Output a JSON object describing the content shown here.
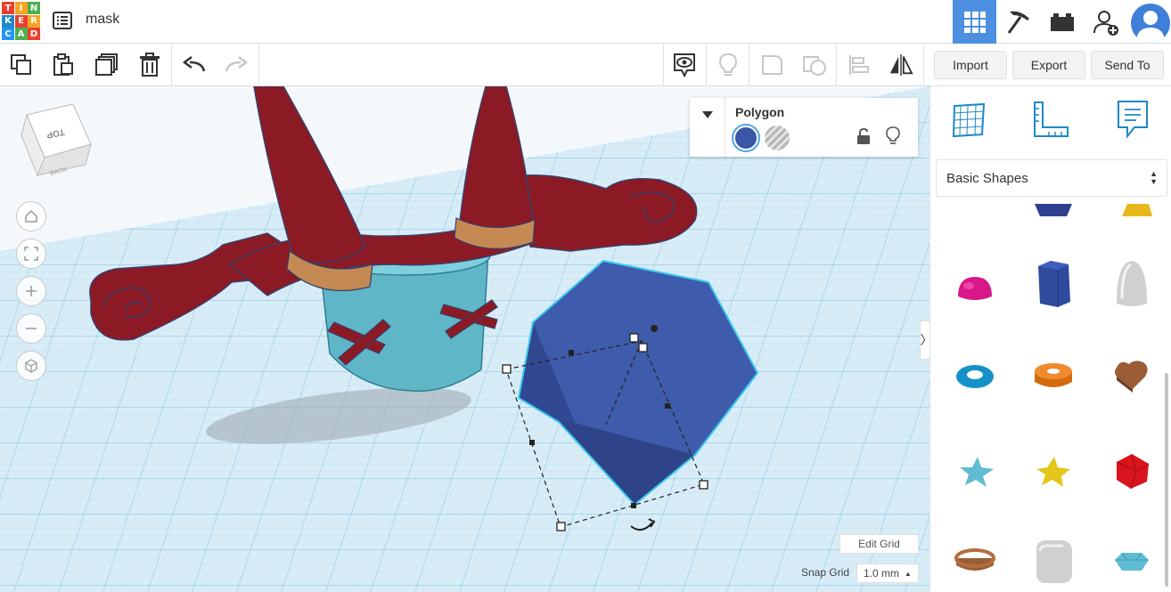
{
  "app": {
    "logo_letters": [
      "T",
      "I",
      "N",
      "K",
      "E",
      "R",
      "C",
      "A",
      "D"
    ],
    "design_name": "mask"
  },
  "topbar": {
    "icons": [
      "grid-apps-icon",
      "pickaxe-icon",
      "bricks-icon",
      "add-user-icon",
      "avatar"
    ],
    "active": "grid-apps-icon"
  },
  "toolbar": {
    "icons": [
      "copy-icon",
      "paste-icon",
      "duplicate-icon",
      "trash-icon",
      "undo-icon",
      "redo-icon",
      "note-view-icon",
      "lightbulb-icon",
      "group-icon",
      "ungroup-icon",
      "align-icon",
      "mirror-icon"
    ],
    "import_label": "Import",
    "export_label": "Export",
    "send_to_label": "Send To"
  },
  "viewcube": {
    "top_label": "TOP",
    "back_label": "BACK"
  },
  "inspector": {
    "title": "Polygon",
    "solid_color": "#3a56a6",
    "icons": [
      "chevron-down-icon",
      "lock-icon",
      "lightbulb-icon"
    ]
  },
  "workplane": {
    "edit_grid_label": "Edit Grid",
    "snap_grid_label": "Snap Grid",
    "snap_grid_value": "1.0 mm"
  },
  "side_panel": {
    "panel_icons": [
      "workplane-icon",
      "ruler-icon",
      "notes-icon"
    ],
    "shape_category": "Basic Shapes",
    "shapes": [
      "half-sphere",
      "polygon",
      "paraboloid",
      "torus",
      "tube",
      "heart",
      "star",
      "star-gold",
      "icosahedron",
      "ring",
      "rounded-cube",
      "diamond"
    ]
  },
  "colors": {
    "accent": "#4d8fe0",
    "grid": "#9fd0e8",
    "selection": "#38c8f0"
  }
}
